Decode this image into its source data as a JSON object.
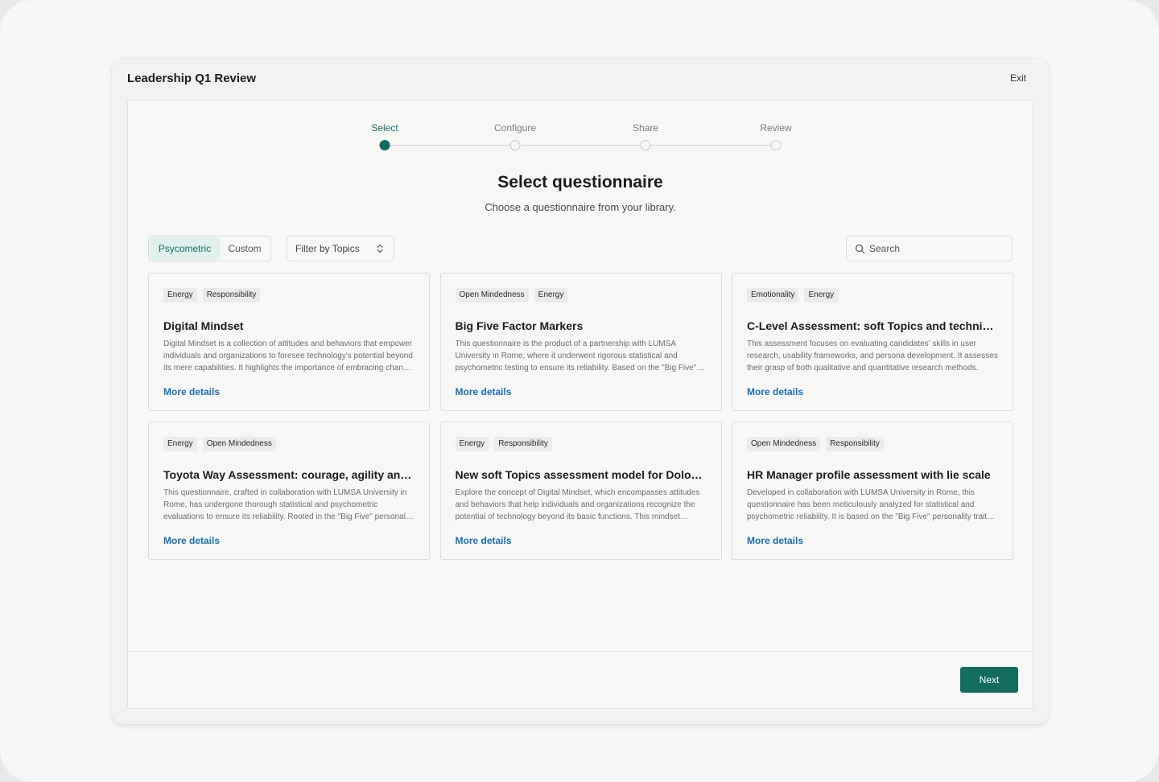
{
  "window": {
    "title": "Leadership Q1 Review",
    "exit_label": "Exit"
  },
  "stepper": {
    "steps": [
      {
        "label": "Select",
        "active": true
      },
      {
        "label": "Configure",
        "active": false
      },
      {
        "label": "Share",
        "active": false
      },
      {
        "label": "Review",
        "active": false
      }
    ]
  },
  "header": {
    "title": "Select questionnaire",
    "subtitle": "Choose a questionnaire from your library."
  },
  "toolbar": {
    "tabs": [
      {
        "label": "Psycometric",
        "selected": true
      },
      {
        "label": "Custom",
        "selected": false
      }
    ],
    "filter_label": "Filter by Topics",
    "search_placeholder": "Search"
  },
  "cards": [
    {
      "tags": [
        "Energy",
        "Responsibility"
      ],
      "title": "Digital Mindset",
      "description": "Digital Mindset is a collection of attitudes and behaviors that empower individuals and organizations to foresee technology's potential beyond its mere capabilities. It highlights the importance of embracing change and innovation.",
      "link": "More details"
    },
    {
      "tags": [
        "Open Mindedness",
        "Energy"
      ],
      "title": "Big Five Factor Markers",
      "description": "This questionnaire is the product of a partnership with LUMSA University in Rome, where it underwent rigorous statistical and psychometric testing to ensure its reliability. Based on the \"Big Five\" personality traits model.",
      "link": "More details"
    },
    {
      "tags": [
        "Emotionality",
        "Energy"
      ],
      "title": "C-Level Assessment: soft Topics and technical expertise",
      "description": "This assessment focuses on evaluating candidates' skills in user research, usability frameworks, and persona development. It assesses their grasp of both qualitative and quantitative research methods.",
      "link": "More details"
    },
    {
      "tags": [
        "Energy",
        "Open Mindedness"
      ],
      "title": "Toyota Way Assessment: courage, agility and collaboration",
      "description": "This questionnaire, crafted in collaboration with LUMSA University in Rome, has undergone thorough statistical and psychometric evaluations to ensure its reliability. Rooted in the \"Big Five\" personality traits model.",
      "link": "More details"
    },
    {
      "tags": [
        "Energy",
        "Responsibility"
      ],
      "title": "New soft Topics assessment model for Dolomiti Energia",
      "description": "Explore the concept of Digital Mindset, which encompasses attitudes and behaviors that help individuals and organizations recognize the potential of technology beyond its basic functions. This mindset emphasizes adaptability.",
      "link": "More details"
    },
    {
      "tags": [
        "Open Mindedness",
        "Responsibility"
      ],
      "title": "HR Manager profile assessment with lie scale",
      "description": "Developed in collaboration with LUMSA University in Rome, this questionnaire has been meticulously analyzed for statistical and psychometric reliability. It is based on the \"Big Five\" personality traits model.",
      "link": "More details"
    }
  ],
  "footer": {
    "next_label": "Next"
  },
  "colors": {
    "accent": "#146c61",
    "accent_light": "#dff0ed",
    "link": "#1b6fb3"
  }
}
